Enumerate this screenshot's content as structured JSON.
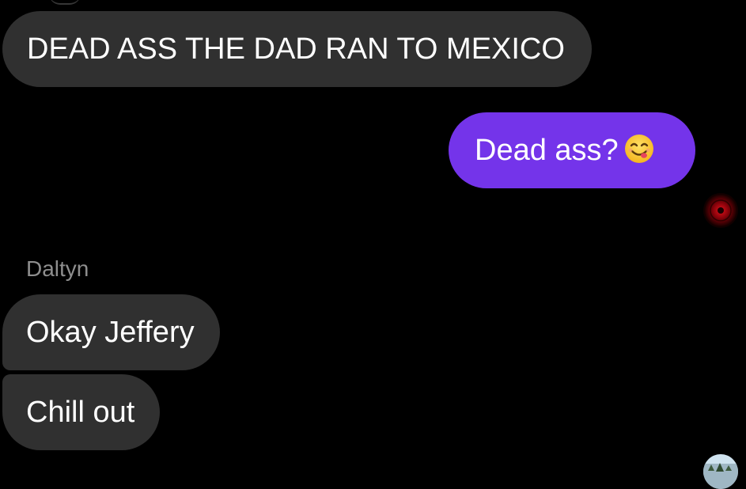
{
  "messages": [
    {
      "sender": "other",
      "text": "DEAD ASS THE DAD RAN TO MEXICO"
    },
    {
      "sender": "me",
      "text": "Dead ass?",
      "emoji": "smiling-face-savoring-food-emoji"
    },
    {
      "sender": "other",
      "text": "Okay Jeffery"
    },
    {
      "sender": "other",
      "text": "Chill out"
    }
  ],
  "sender_name": "Daltyn",
  "avatars": {
    "read_receipt": "red-eye-avatar",
    "bottom": "landscape-avatar"
  },
  "colors": {
    "background": "#000000",
    "incoming_bubble": "#303030",
    "outgoing_bubble": "#7434ea",
    "sender_name": "#8e8e8e"
  }
}
